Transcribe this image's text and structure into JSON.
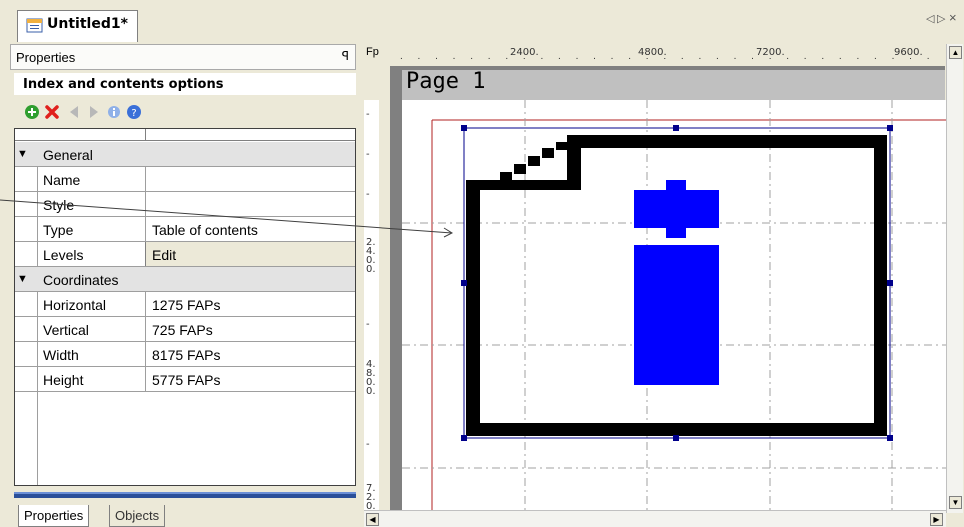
{
  "document_tab": {
    "title": "Untitled1*",
    "nav_left": "◁",
    "nav_right": "▷",
    "close": "×"
  },
  "properties_panel": {
    "title": "Properties",
    "pin": "ꟼ",
    "options_title": "Index and contents options",
    "toolbar": [
      "add-icon",
      "delete-icon",
      "move-left-icon",
      "move-right-icon",
      "info-icon",
      "help-icon"
    ],
    "sections": [
      {
        "label": "General",
        "rows": [
          {
            "name": "Name",
            "value": ""
          },
          {
            "name": "Style",
            "value": ""
          },
          {
            "name": "Type",
            "value": "Table of contents"
          },
          {
            "name": "Levels",
            "value": "Edit"
          }
        ]
      },
      {
        "label": "Coordinates",
        "rows": [
          {
            "name": "Horizontal",
            "value": "1275 FAPs"
          },
          {
            "name": "Vertical",
            "value": "725 FAPs"
          },
          {
            "name": "Width",
            "value": "8175 FAPs"
          },
          {
            "name": "Height",
            "value": "5775 FAPs"
          }
        ]
      }
    ],
    "bottom_tabs": [
      "Properties",
      "Objects"
    ]
  },
  "canvas": {
    "corner_label": "Fp",
    "ruler_labels": [
      "2400.",
      "4800.",
      "7200.",
      "9600."
    ],
    "vertical_ruler_labels": [
      "2.4.0.0.",
      "4.8.0.0.",
      "7.2.0.0."
    ],
    "page_title": "Page 1",
    "scroll_up": "▲",
    "scroll_down": "▼",
    "scroll_left": "◀",
    "scroll_right": "▶"
  },
  "colors": {
    "accent_blue": "#0000ff",
    "frame_red": "#b22222",
    "selection": "#00008b"
  }
}
